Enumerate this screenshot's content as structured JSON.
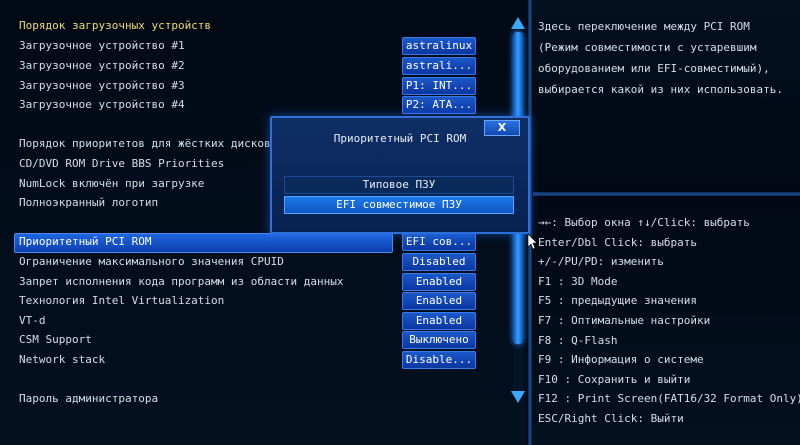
{
  "menu": [
    {
      "label": "Порядок загрузочных устройств",
      "heading": true
    },
    {
      "label": "Загрузочное устройство #1",
      "value": "astralinux"
    },
    {
      "label": "Загрузочное устройство #2",
      "value": "astrali..."
    },
    {
      "label": "Загрузочное устройство #3",
      "value": "P1: INT..."
    },
    {
      "label": "Загрузочное устройство #4",
      "value": "P2: ATA..."
    },
    {
      "label": "Порядок приоритетов для жёстких дисков"
    },
    {
      "label": "CD/DVD ROM Drive BBS Priorities"
    },
    {
      "label": "NumLock включён при загрузке"
    },
    {
      "label": "Полноэкранный логотип"
    },
    {
      "label": "Приоритетный PCI ROM",
      "value": "EFI сов...",
      "selected": true
    },
    {
      "label": "Ограничение максимального значения CPUID",
      "value": "Disabled"
    },
    {
      "label": "Запрет исполнения кода программ из области данных",
      "value": "Enabled"
    },
    {
      "label": "Технология Intel Virtualization",
      "value": "Enabled"
    },
    {
      "label": "VT-d",
      "value": "Enabled"
    },
    {
      "label": "CSM Support",
      "value": "Выключено"
    },
    {
      "label": "Network stack",
      "value": "Disable..."
    },
    {
      "label": "Пароль администратора"
    }
  ],
  "help": {
    "text": "Здесь переключение между PCI ROM (Режим совместимости с устаревшим оборудованием или EFI-совместимый), выбирается какой из них использовать."
  },
  "keys": [
    "→←: Выбор окна  ↑↓/Click: выбрать",
    "Enter/Dbl Click: выбрать",
    "+/-/PU/PD: изменить",
    "F1  : 3D Mode",
    "F5  : предыдущие значения",
    "F7  : Оптимальные настройки",
    "F8  : Q-Flash",
    "F9  : Информация о системе",
    "F10 : Сохранить и выйти",
    "F12 : Print Screen(FAT16/32 Format Only)",
    "ESC/Right Click: Выйти"
  ],
  "popup": {
    "title": "Приоритетный PCI ROM",
    "close": "X",
    "options": [
      "Типовое ПЗУ",
      "EFI совместимое ПЗУ"
    ],
    "selected_index": 1
  },
  "colors": {
    "accent": "#1b58c8",
    "heading": "#f0d870",
    "scrollbar": "#36a0ff"
  },
  "icons": {
    "scroll_up": "triangle-up-icon",
    "scroll_down": "triangle-down-icon",
    "cursor": "mouse-pointer-icon"
  }
}
